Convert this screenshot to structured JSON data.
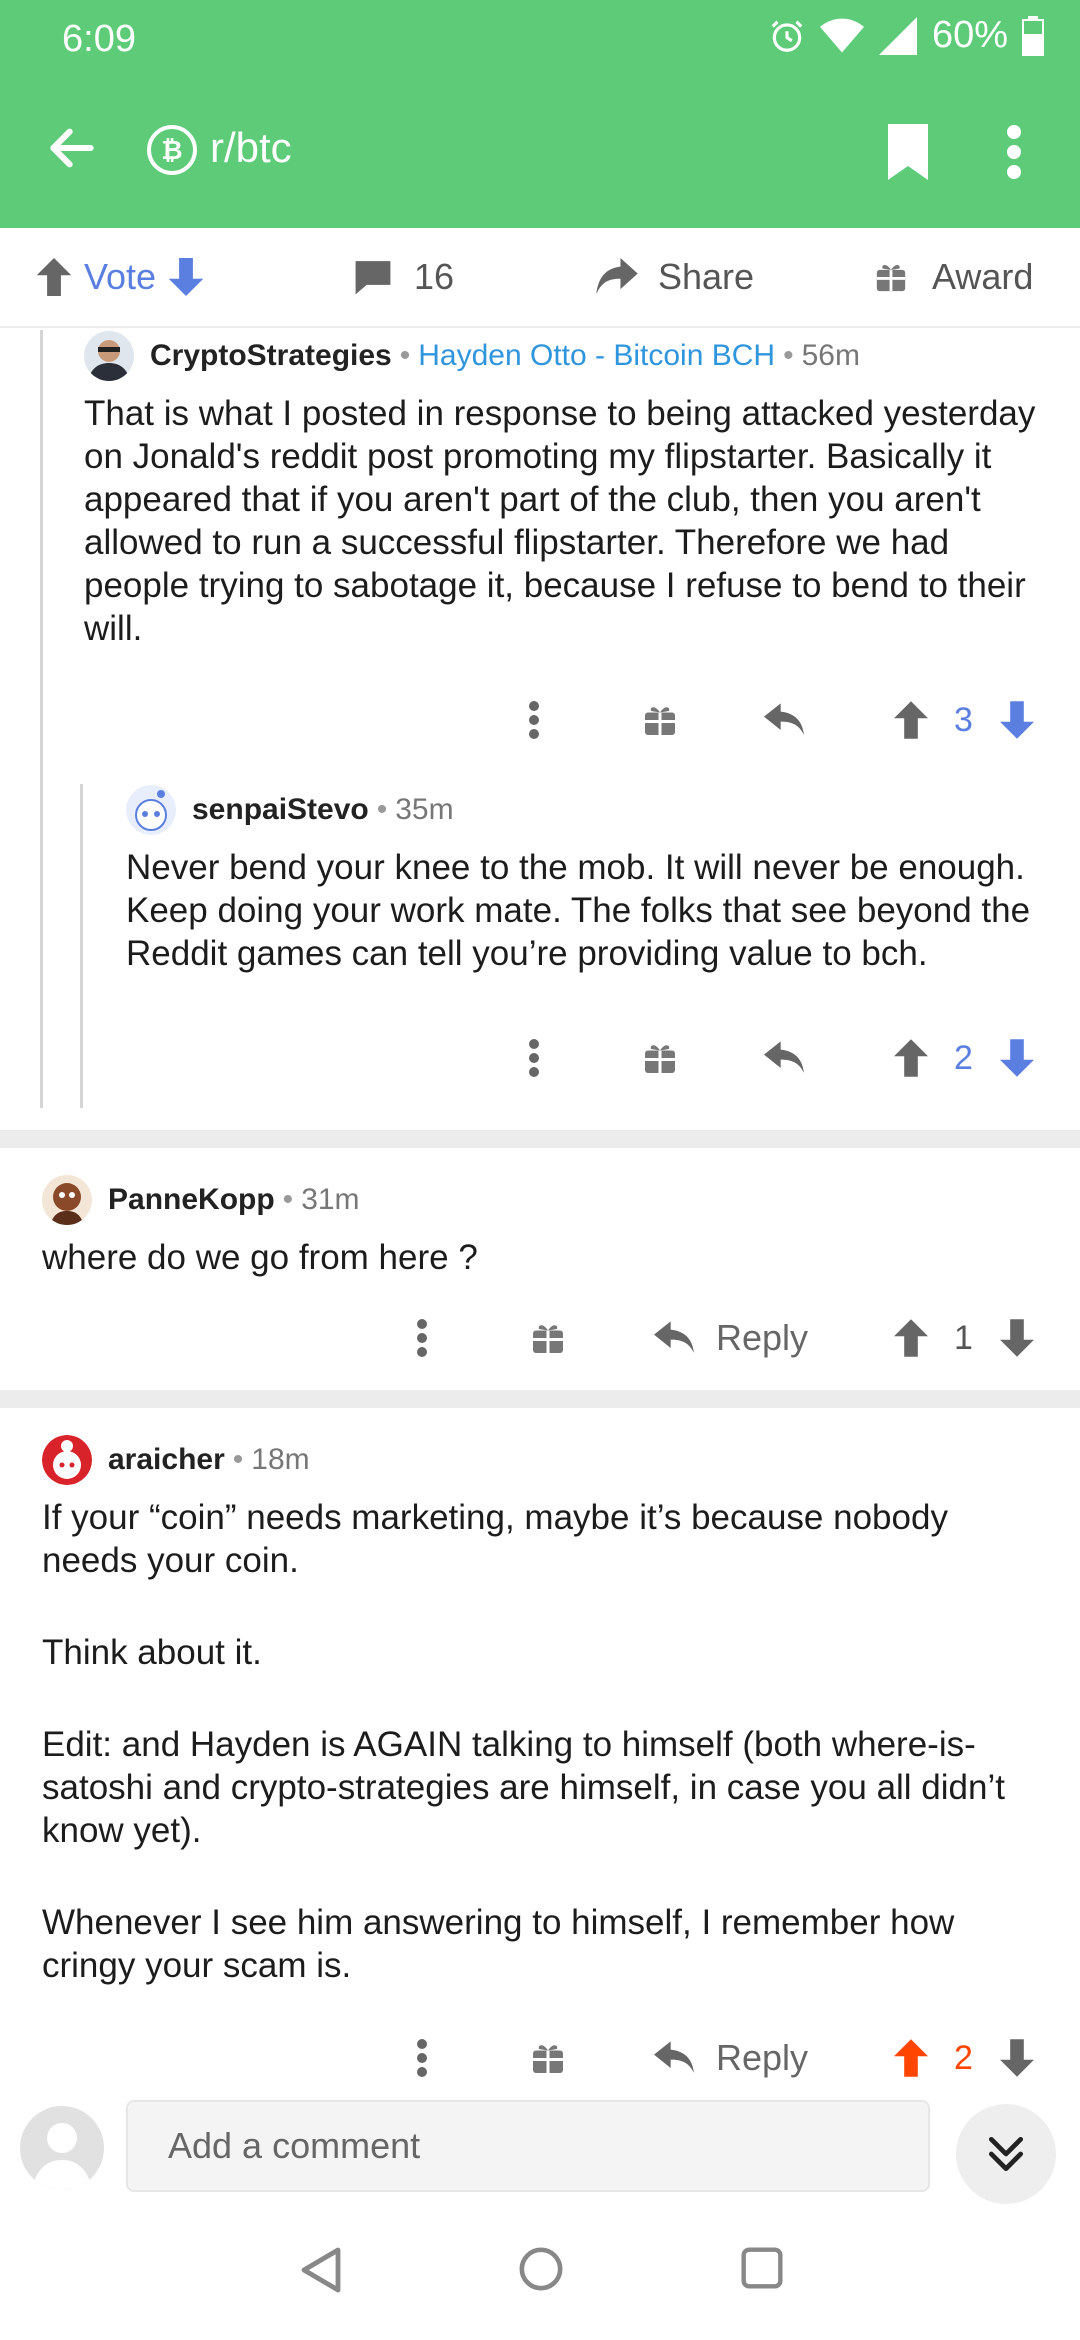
{
  "status": {
    "time": "6:09",
    "battery": "60%"
  },
  "header": {
    "title": "r/btc"
  },
  "action_bar": {
    "vote_label": "Vote",
    "comments_count": "16",
    "share_label": "Share",
    "award_label": "Award"
  },
  "comments": [
    {
      "author": "CryptoStrategies",
      "flair": "Hayden Otto - Bitcoin BCH",
      "time": "56m",
      "body": [
        "That is what I posted in response to being attacked yesterday on Jonald's reddit post promoting my flipstarter. Basically it appeared that if you aren't part of the club, then you aren't allowed to run a successful flipstarter. Therefore we had people trying to sabotage it, because I refuse to bend to their will."
      ],
      "score": "3"
    },
    {
      "author": "senpaiStevo",
      "time": "35m",
      "body": [
        "Never bend your knee to the mob. It will never be enough. Keep doing your work mate. The folks that see beyond the Reddit games can tell you’re providing value to bch."
      ],
      "score": "2"
    },
    {
      "author": "PanneKopp",
      "time": "31m",
      "body": [
        "where do we go from here ?"
      ],
      "reply_label": "Reply",
      "score": "1"
    },
    {
      "author": "araicher",
      "time": "18m",
      "body": [
        "If your “coin” needs marketing, maybe it’s because nobody needs your coin.",
        "Think about it.",
        "Edit: and Hayden is AGAIN talking to himself (both where-is-satoshi and crypto-strategies are himself, in case you all didn’t know yet).",
        "Whenever I see him answering to himself, I remember how cringy your scam is."
      ],
      "reply_label": "Reply",
      "score": "2"
    }
  ],
  "comment_input": {
    "placeholder": "Add a comment"
  },
  "colors": {
    "header": "#5ecb79",
    "upvote_active": "#ff4500",
    "vote_blue": "#5b7fe0",
    "flair": "#2f95dc"
  }
}
